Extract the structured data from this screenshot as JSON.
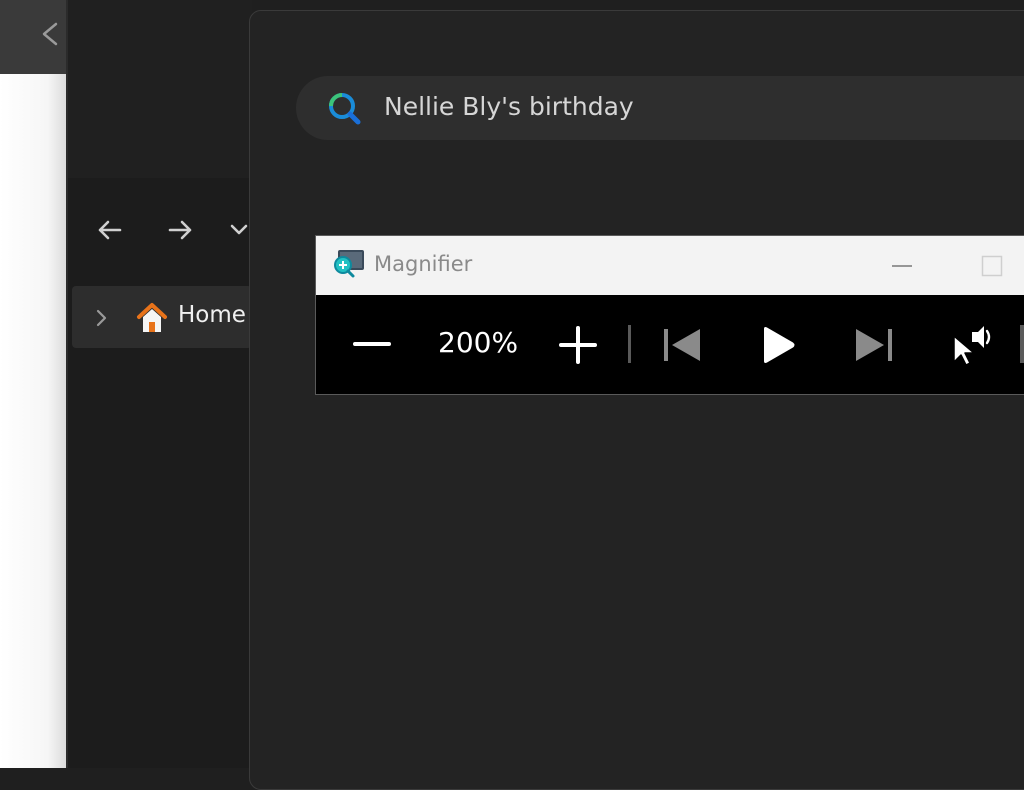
{
  "background_app": {
    "back_icon": "arrow-left-icon"
  },
  "explorer": {
    "nav": {
      "back_icon": "arrow-left-icon",
      "forward_icon": "arrow-right-icon",
      "recent_icon": "chevron-down-icon"
    },
    "tree": {
      "home_label": "Home",
      "home_icon": "home-icon",
      "expand_icon": "chevron-right-icon"
    }
  },
  "search": {
    "query": "Nellie Bly's birthday",
    "icon": "search-icon"
  },
  "magnifier": {
    "title": "Magnifier",
    "app_icon": "magnifier-icon",
    "zoom_level": "200%",
    "controls": {
      "zoom_out_icon": "minus-icon",
      "zoom_in_icon": "plus-icon",
      "previous_icon": "skip-previous-icon",
      "play_icon": "play-icon",
      "next_icon": "skip-next-icon",
      "read_from_here_icon": "read-from-pointer-icon"
    },
    "window_controls": {
      "minimize_icon": "minimize-icon",
      "maximize_icon": "maximize-icon"
    }
  },
  "colors": {
    "search_accent_blue": "#1a8cd8",
    "search_accent_green": "#3cc47a",
    "home_roof": "#e8731a"
  }
}
